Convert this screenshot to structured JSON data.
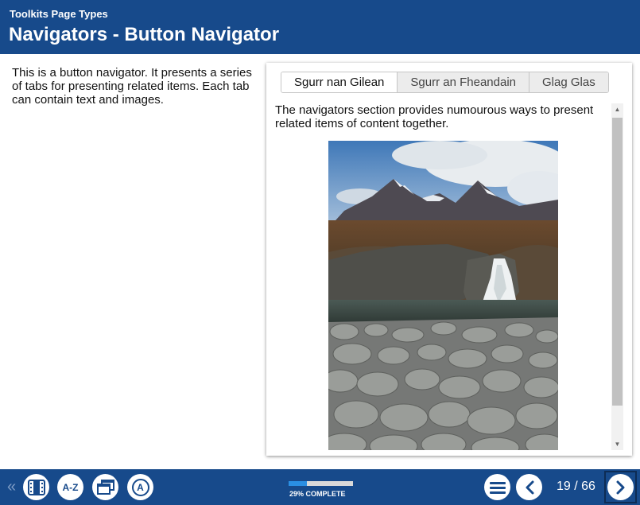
{
  "header": {
    "section_title": "Toolkits Page Types",
    "page_title": "Navigators - Button Navigator"
  },
  "intro": {
    "text": "This is a button navigator. It presents a series of tabs for presenting related items. Each tab can contain text and images."
  },
  "navigator": {
    "tabs": [
      {
        "label": "Sgurr nan Gilean",
        "active": true
      },
      {
        "label": "Sgurr an Fheandain",
        "active": false
      },
      {
        "label": "Glag Glas",
        "active": false
      }
    ],
    "content_text": "The navigators section provides numourous ways to present related items of content together.",
    "image_icon": "mountain-waterfall-photo"
  },
  "footer": {
    "progress_percent": 29,
    "progress_label": "29% COMPLETE",
    "page_count": "19 / 66",
    "az_label": "A-Z",
    "a_label": "A",
    "icons": [
      "double-chevron-left-icon",
      "film-icon",
      "az-index-icon",
      "windows-icon",
      "a-text-icon",
      "menu-icon",
      "previous-icon",
      "next-icon"
    ]
  },
  "colors": {
    "brand": "#174a8b",
    "progress": "#2a8fe3"
  }
}
